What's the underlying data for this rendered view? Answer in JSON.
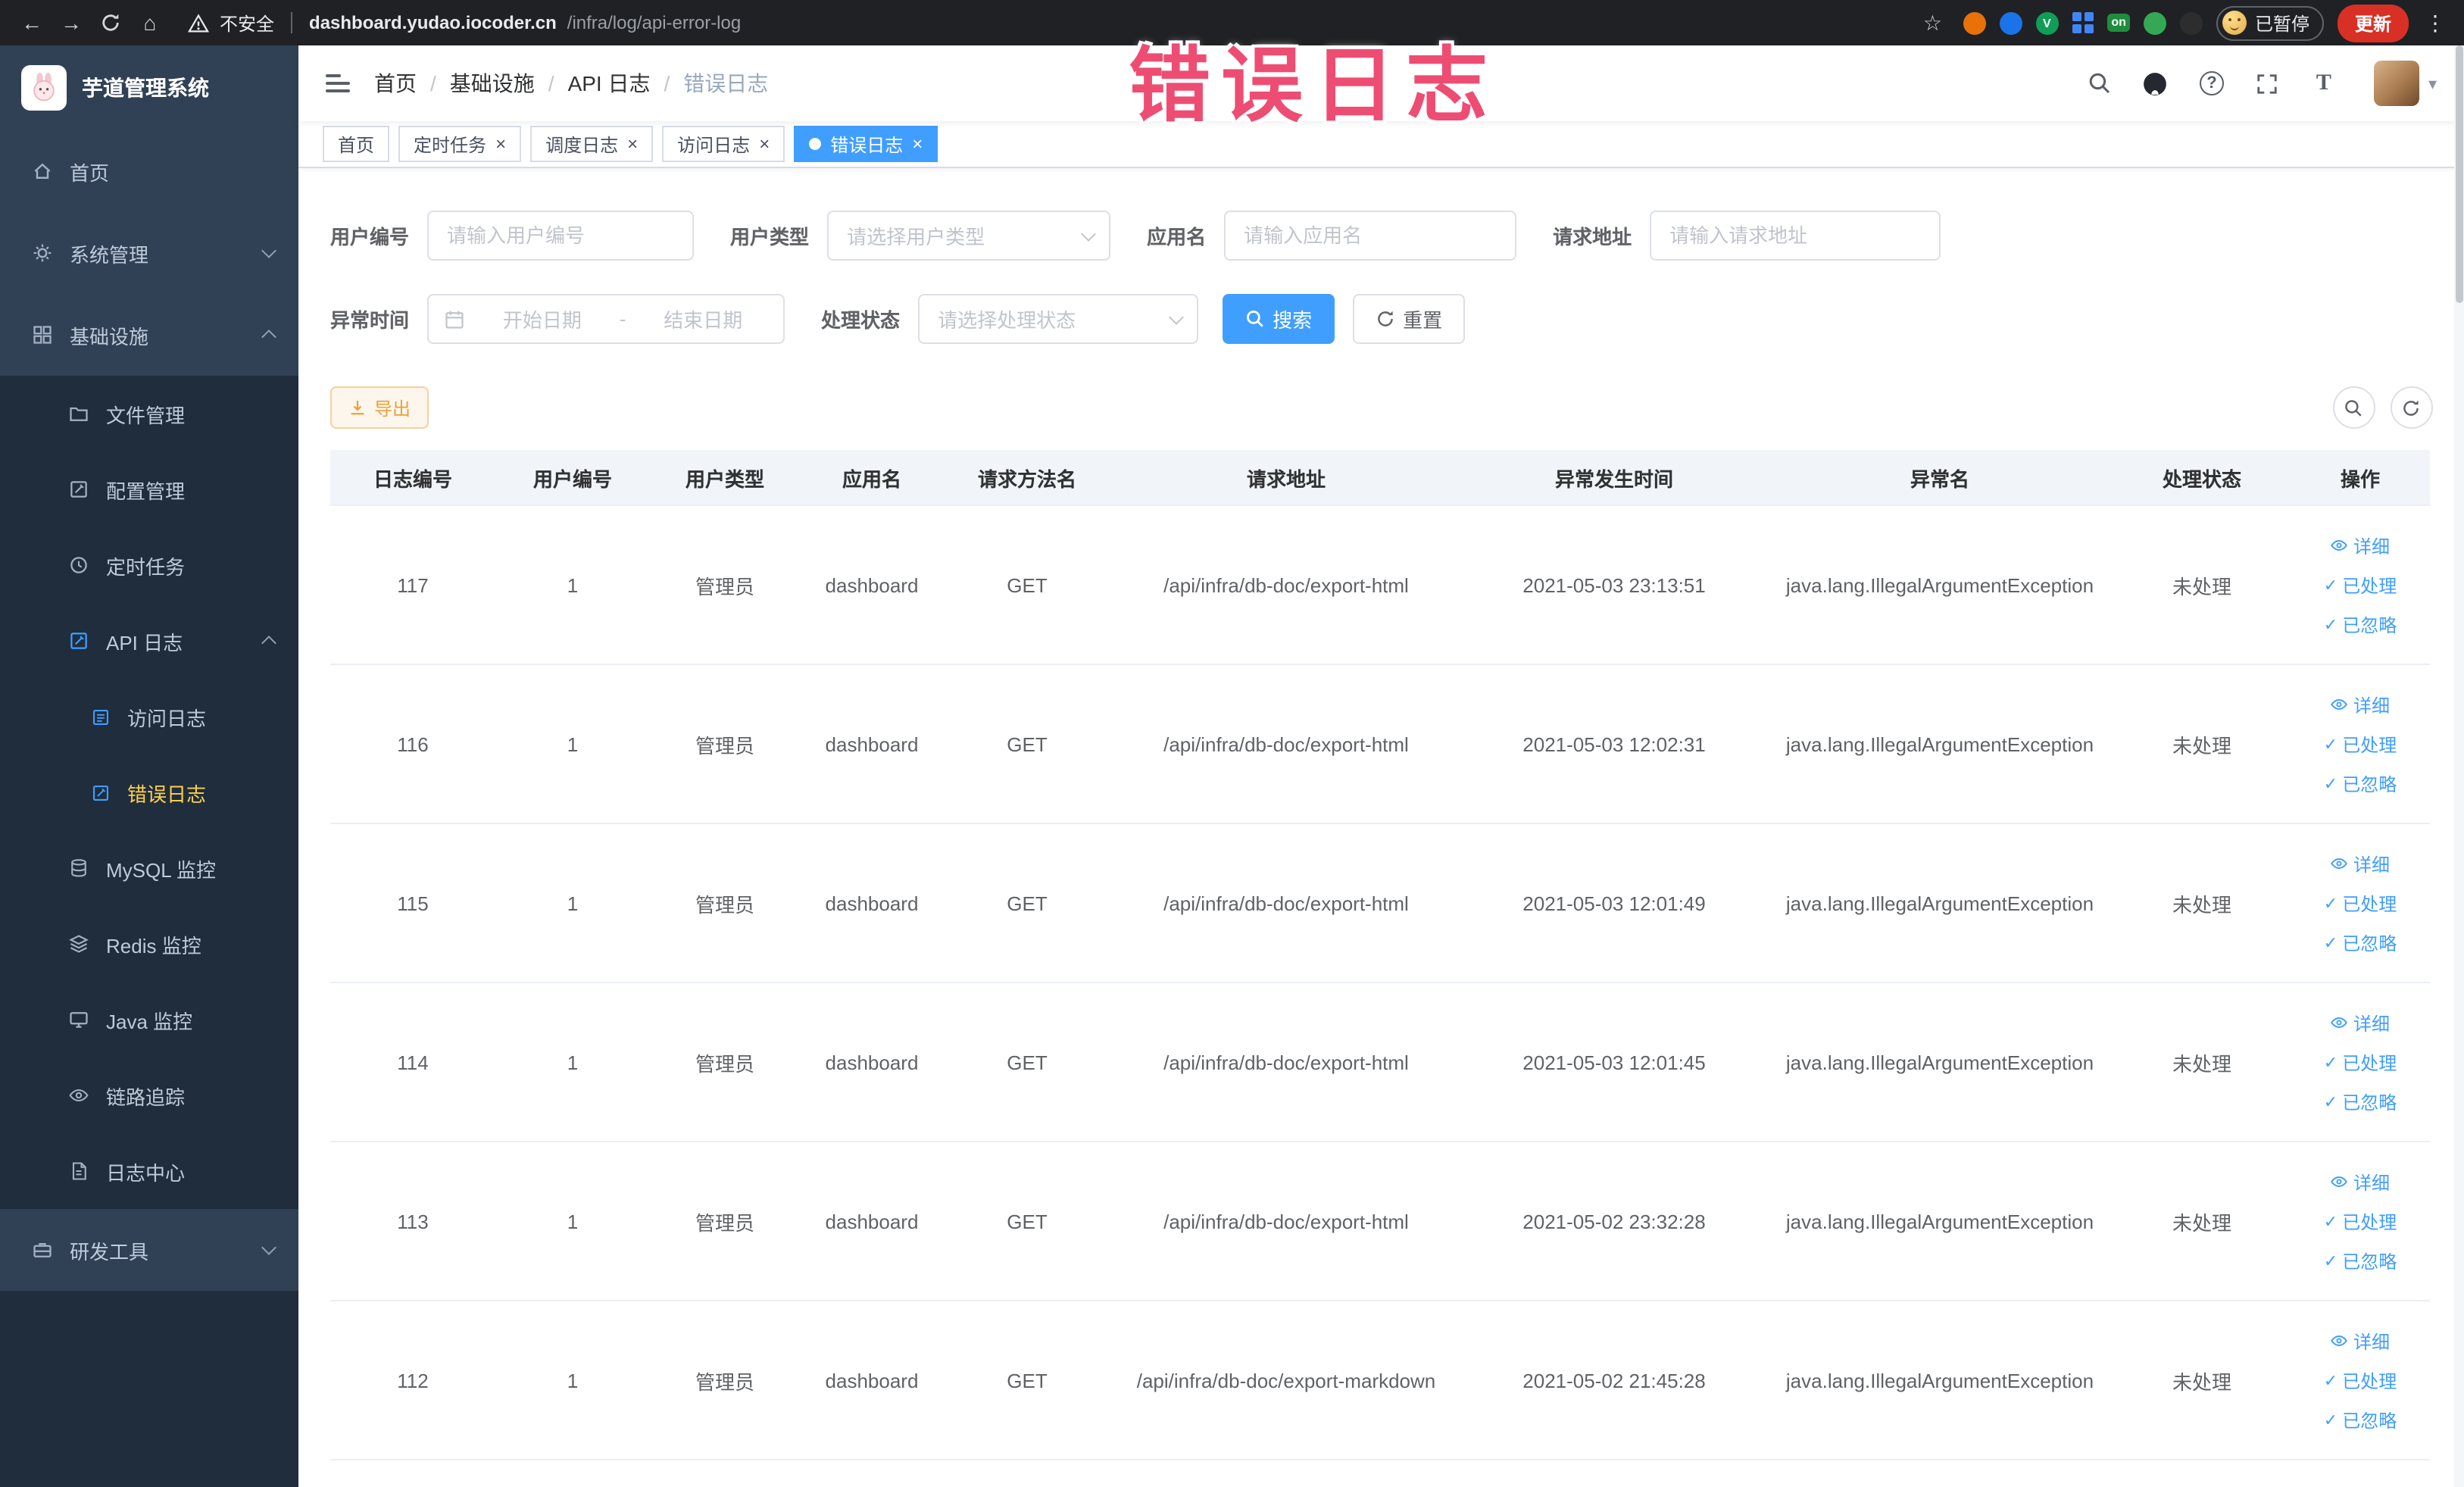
{
  "colors": {
    "accent_blue": "#409eff",
    "sidebar_bg": "#304156",
    "submenu_bg": "#1f2d3d",
    "active_menu_text": "#ffd04b",
    "warning_btn_bg": "#fdf6ec",
    "warning_btn_border": "#f3d19e",
    "warning_btn_text": "#e6a23c",
    "overlay_red": "#ee4d73",
    "update_btn_red": "#d93025",
    "browser_bar_bg": "#202124"
  },
  "browser": {
    "security_label": "不安全",
    "url_host": "dashboard.yudao.iocoder.cn",
    "url_path": "/infra/log/api-error-log",
    "extension_v_label": "V",
    "extension_on_badge": "on",
    "paused_badge": "已暂停",
    "update_button": "更新"
  },
  "overlay_title": "错误日志",
  "sidebar": {
    "logo_title": "芋道管理系统",
    "items": [
      {
        "label": "首页"
      },
      {
        "label": "系统管理"
      },
      {
        "label": "基础设施"
      },
      {
        "label": "文件管理"
      },
      {
        "label": "配置管理"
      },
      {
        "label": "定时任务"
      },
      {
        "label": "API 日志"
      },
      {
        "label": "访问日志"
      },
      {
        "label": "错误日志"
      },
      {
        "label": "MySQL 监控"
      },
      {
        "label": "Redis 监控"
      },
      {
        "label": "Java 监控"
      },
      {
        "label": "链路追踪"
      },
      {
        "label": "日志中心"
      },
      {
        "label": "研发工具"
      }
    ]
  },
  "breadcrumb": {
    "separator": "/",
    "items": [
      "首页",
      "基础设施",
      "API 日志",
      "错误日志"
    ]
  },
  "tabs": [
    {
      "label": "首页"
    },
    {
      "label": "定时任务"
    },
    {
      "label": "调度日志"
    },
    {
      "label": "访问日志"
    },
    {
      "label": "错误日志"
    }
  ],
  "filters": {
    "user_id_label": "用户编号",
    "user_id_placeholder": "请输入用户编号",
    "user_type_label": "用户类型",
    "user_type_placeholder": "请选择用户类型",
    "app_name_label": "应用名",
    "app_name_placeholder": "请输入应用名",
    "request_url_label": "请求地址",
    "request_url_placeholder": "请输入请求地址",
    "exception_time_label": "异常时间",
    "date_start_placeholder": "开始日期",
    "date_separator": "-",
    "date_end_placeholder": "结束日期",
    "process_status_label": "处理状态",
    "process_status_placeholder": "请选择处理状态",
    "search_button": "搜索",
    "reset_button": "重置"
  },
  "toolbar": {
    "export_button": "导出"
  },
  "table": {
    "columns": [
      "日志编号",
      "用户编号",
      "用户类型",
      "应用名",
      "请求方法名",
      "请求地址",
      "异常发生时间",
      "异常名",
      "处理状态",
      "操作"
    ],
    "action_detail": "详细",
    "action_processed": "已处理",
    "action_ignored": "已忽略",
    "rows": [
      {
        "id": "117",
        "user_id": "1",
        "user_type": "管理员",
        "app": "dashboard",
        "method": "GET",
        "url": "/api/infra/db-doc/export-html",
        "time": "2021-05-03 23:13:51",
        "exception": "java.lang.IllegalArgumentException",
        "status": "未处理"
      },
      {
        "id": "116",
        "user_id": "1",
        "user_type": "管理员",
        "app": "dashboard",
        "method": "GET",
        "url": "/api/infra/db-doc/export-html",
        "time": "2021-05-03 12:02:31",
        "exception": "java.lang.IllegalArgumentException",
        "status": "未处理"
      },
      {
        "id": "115",
        "user_id": "1",
        "user_type": "管理员",
        "app": "dashboard",
        "method": "GET",
        "url": "/api/infra/db-doc/export-html",
        "time": "2021-05-03 12:01:49",
        "exception": "java.lang.IllegalArgumentException",
        "status": "未处理"
      },
      {
        "id": "114",
        "user_id": "1",
        "user_type": "管理员",
        "app": "dashboard",
        "method": "GET",
        "url": "/api/infra/db-doc/export-html",
        "time": "2021-05-03 12:01:45",
        "exception": "java.lang.IllegalArgumentException",
        "status": "未处理"
      },
      {
        "id": "113",
        "user_id": "1",
        "user_type": "管理员",
        "app": "dashboard",
        "method": "GET",
        "url": "/api/infra/db-doc/export-html",
        "time": "2021-05-02 23:32:28",
        "exception": "java.lang.IllegalArgumentException",
        "status": "未处理"
      },
      {
        "id": "112",
        "user_id": "1",
        "user_type": "管理员",
        "app": "dashboard",
        "method": "GET",
        "url": "/api/infra/db-doc/export-markdown",
        "time": "2021-05-02 21:45:28",
        "exception": "java.lang.IllegalArgumentException",
        "status": "未处理"
      }
    ]
  },
  "icons": {
    "back": "←",
    "forward": "→",
    "home": "⌂",
    "star": "☆",
    "kebab": "⋮",
    "close": "×",
    "check": "✓",
    "question": "?",
    "caret": "▾",
    "font": "T"
  }
}
